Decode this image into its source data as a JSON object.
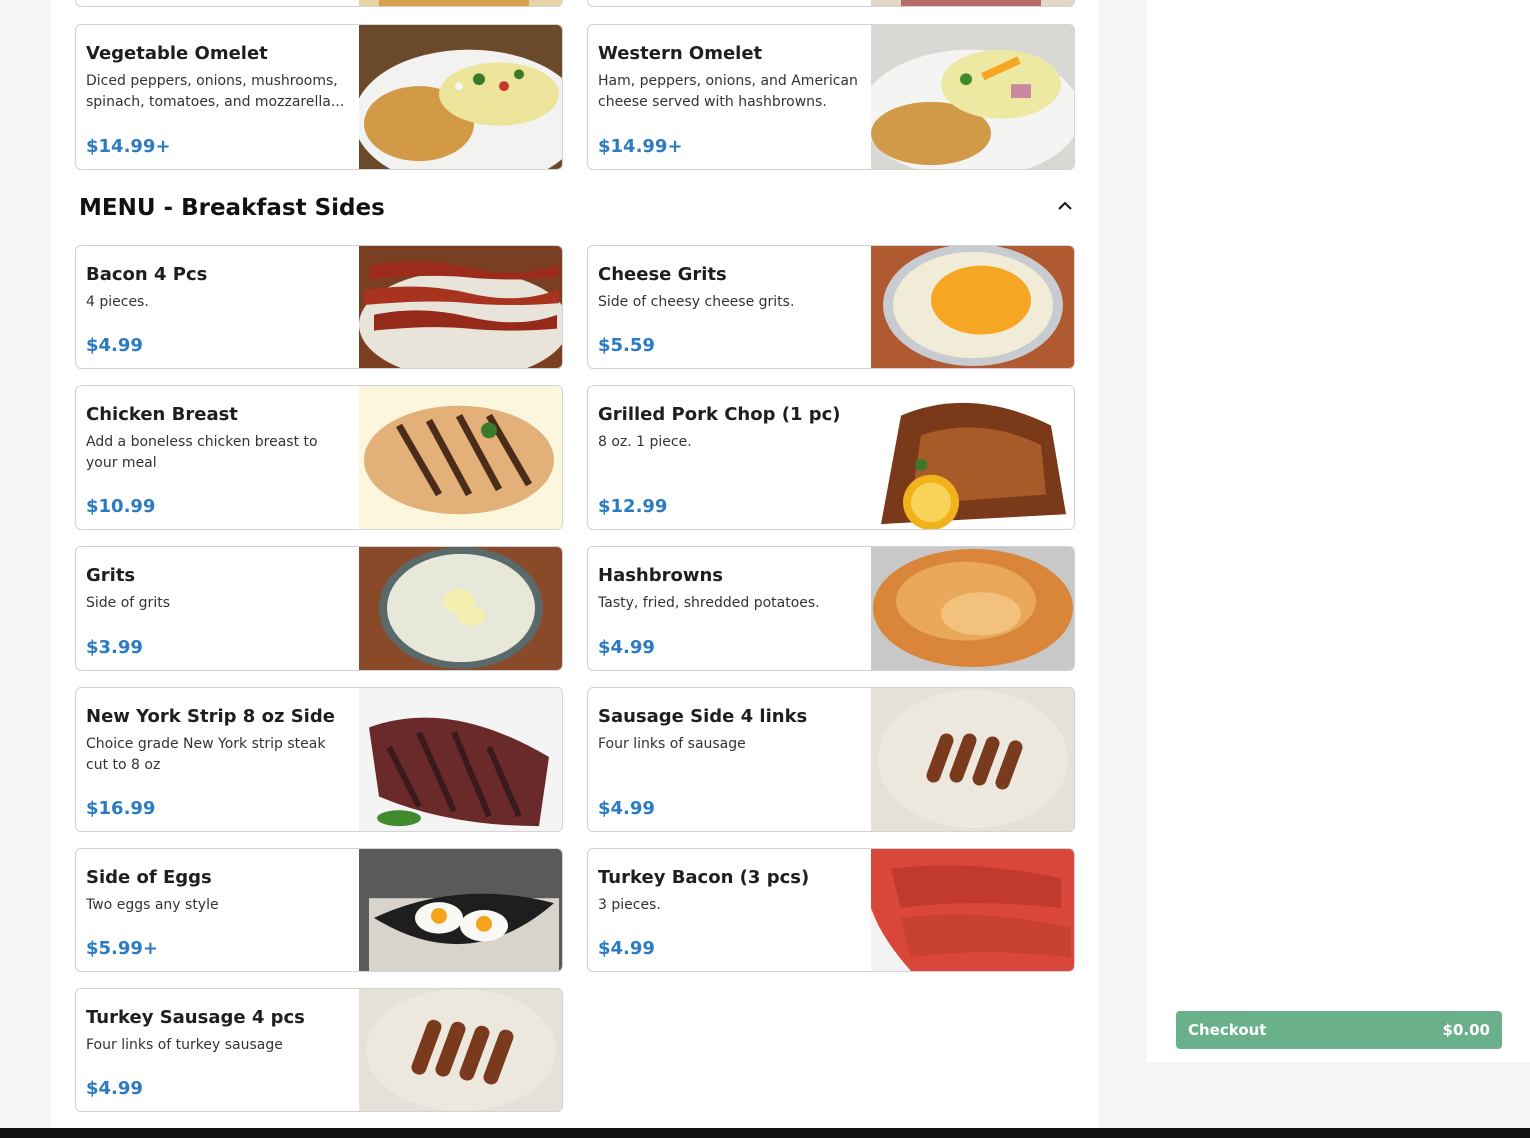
{
  "omelets": [
    {
      "name": "Vegetable Omelet",
      "description": "Diced peppers, onions, mushrooms, spinach, tomatoes, and mozzarella...",
      "price": "$14.99+",
      "image": "vegetable-omelet-photo"
    },
    {
      "name": "Western Omelet",
      "description": "Ham, peppers, onions, and American cheese served with hashbrowns.",
      "price": "$14.99+",
      "image": "western-omelet-photo"
    }
  ],
  "section": {
    "title": "MENU - Breakfast Sides",
    "toggle_icon": "chevron-up-icon"
  },
  "sides": [
    {
      "name": "Bacon 4 Pcs",
      "description": "4 pieces.",
      "price": "$4.99",
      "image": "bacon-photo"
    },
    {
      "name": "Cheese Grits",
      "description": "Side of cheesy cheese grits.",
      "price": "$5.59",
      "image": "cheese-grits-photo"
    },
    {
      "name": "Chicken Breast",
      "description": "Add a boneless chicken breast to your meal",
      "price": "$10.99",
      "image": "chicken-breast-photo"
    },
    {
      "name": "Grilled Pork Chop (1 pc)",
      "description": "8 oz. 1 piece.",
      "price": "$12.99",
      "image": "pork-chop-photo"
    },
    {
      "name": "Grits",
      "description": "Side of grits",
      "price": "$3.99",
      "image": "grits-photo"
    },
    {
      "name": "Hashbrowns",
      "description": "Tasty, fried, shredded potatoes.",
      "price": "$4.99",
      "image": "hashbrowns-photo"
    },
    {
      "name": "New York Strip 8 oz Side",
      "description": "Choice grade New York strip steak cut to 8 oz",
      "price": "$16.99",
      "image": "steak-photo"
    },
    {
      "name": "Sausage Side 4 links",
      "description": "Four links of sausage",
      "price": "$4.99",
      "image": "sausage-photo"
    },
    {
      "name": "Side of Eggs",
      "description": "Two eggs any style",
      "price": "$5.99+",
      "image": "eggs-photo"
    },
    {
      "name": "Turkey Bacon (3 pcs)",
      "description": "3 pieces.",
      "price": "$4.99",
      "image": "turkey-bacon-photo"
    },
    {
      "name": "Turkey Sausage 4 pcs",
      "description": "Four links of turkey sausage",
      "price": "$4.99",
      "image": "turkey-sausage-photo"
    }
  ],
  "checkout": {
    "label": "Checkout",
    "amount": "$0.00"
  },
  "colors": {
    "price": "#2a7bc1",
    "checkout": "#6ab08b",
    "border": "#d3d3d3"
  }
}
